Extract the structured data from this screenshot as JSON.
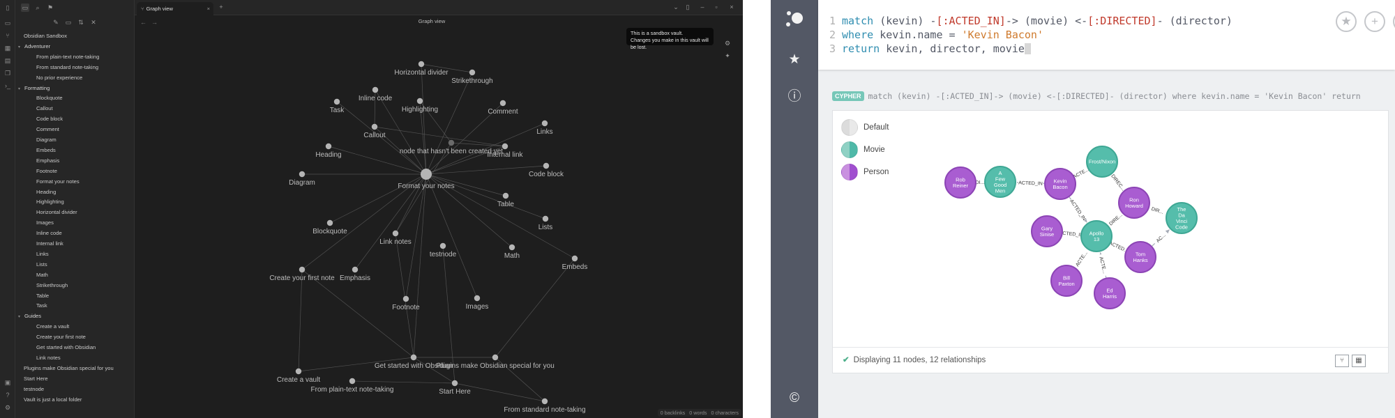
{
  "obsidian": {
    "tab_label": "Graph view",
    "graph_title": "Graph view",
    "tooltip_line1": "This is a sandbox vault.",
    "tooltip_line2": "Changes you make in this vault will be lost.",
    "status": {
      "backlinks": "0 backlinks",
      "words": "0 words",
      "characters": "0 characters"
    },
    "tree": [
      {
        "label": "Obsidian Sandbox",
        "level": 0,
        "kind": "root"
      },
      {
        "label": "Adventurer",
        "level": 0,
        "kind": "folder"
      },
      {
        "label": "From plain-text note-taking",
        "level": 1,
        "kind": "file"
      },
      {
        "label": "From standard note-taking",
        "level": 1,
        "kind": "file"
      },
      {
        "label": "No prior experience",
        "level": 1,
        "kind": "file"
      },
      {
        "label": "Formatting",
        "level": 0,
        "kind": "folder"
      },
      {
        "label": "Blockquote",
        "level": 1,
        "kind": "file"
      },
      {
        "label": "Callout",
        "level": 1,
        "kind": "file"
      },
      {
        "label": "Code block",
        "level": 1,
        "kind": "file"
      },
      {
        "label": "Comment",
        "level": 1,
        "kind": "file"
      },
      {
        "label": "Diagram",
        "level": 1,
        "kind": "file"
      },
      {
        "label": "Embeds",
        "level": 1,
        "kind": "file"
      },
      {
        "label": "Emphasis",
        "level": 1,
        "kind": "file"
      },
      {
        "label": "Footnote",
        "level": 1,
        "kind": "file"
      },
      {
        "label": "Format your notes",
        "level": 1,
        "kind": "file"
      },
      {
        "label": "Heading",
        "level": 1,
        "kind": "file"
      },
      {
        "label": "Highlighting",
        "level": 1,
        "kind": "file"
      },
      {
        "label": "Horizontal divider",
        "level": 1,
        "kind": "file"
      },
      {
        "label": "Images",
        "level": 1,
        "kind": "file"
      },
      {
        "label": "Inline code",
        "level": 1,
        "kind": "file"
      },
      {
        "label": "Internal link",
        "level": 1,
        "kind": "file"
      },
      {
        "label": "Links",
        "level": 1,
        "kind": "file"
      },
      {
        "label": "Lists",
        "level": 1,
        "kind": "file"
      },
      {
        "label": "Math",
        "level": 1,
        "kind": "file"
      },
      {
        "label": "Strikethrough",
        "level": 1,
        "kind": "file"
      },
      {
        "label": "Table",
        "level": 1,
        "kind": "file"
      },
      {
        "label": "Task",
        "level": 1,
        "kind": "file"
      },
      {
        "label": "Guides",
        "level": 0,
        "kind": "folder"
      },
      {
        "label": "Create a vault",
        "level": 1,
        "kind": "file"
      },
      {
        "label": "Create your first note",
        "level": 1,
        "kind": "file"
      },
      {
        "label": "Get started with Obsidian",
        "level": 1,
        "kind": "file"
      },
      {
        "label": "Link notes",
        "level": 1,
        "kind": "file"
      },
      {
        "label": "Plugins make Obsidian special for you",
        "level": 0,
        "kind": "file"
      },
      {
        "label": "Start Here",
        "level": 0,
        "kind": "file"
      },
      {
        "label": "testnode",
        "level": 0,
        "kind": "file"
      },
      {
        "label": "Vault is just a local folder",
        "level": 0,
        "kind": "file"
      }
    ],
    "graph_nodes": [
      {
        "id": "hdiv",
        "label": "Horizontal divider"
      },
      {
        "id": "strike",
        "label": "Strikethrough"
      },
      {
        "id": "inline",
        "label": "Inline code"
      },
      {
        "id": "task",
        "label": "Task"
      },
      {
        "id": "highlight",
        "label": "Highlighting"
      },
      {
        "id": "comment",
        "label": "Comment"
      },
      {
        "id": "links",
        "label": "Links"
      },
      {
        "id": "callout",
        "label": "Callout"
      },
      {
        "id": "notcreated",
        "label": "node that hasn't been created yet"
      },
      {
        "id": "heading",
        "label": "Heading"
      },
      {
        "id": "internal",
        "label": "Internal link"
      },
      {
        "id": "codeblock",
        "label": "Code block"
      },
      {
        "id": "diagram",
        "label": "Diagram"
      },
      {
        "id": "format",
        "label": "Format your notes"
      },
      {
        "id": "table",
        "label": "Table"
      },
      {
        "id": "lists",
        "label": "Lists"
      },
      {
        "id": "blockquote",
        "label": "Blockquote"
      },
      {
        "id": "linknotes",
        "label": "Link notes"
      },
      {
        "id": "testnode",
        "label": "testnode"
      },
      {
        "id": "math",
        "label": "Math"
      },
      {
        "id": "embeds",
        "label": "Embeds"
      },
      {
        "id": "firstnote",
        "label": "Create your first note"
      },
      {
        "id": "emphasis",
        "label": "Emphasis"
      },
      {
        "id": "footnote",
        "label": "Footnote"
      },
      {
        "id": "images",
        "label": "Images"
      },
      {
        "id": "getstarted",
        "label": "Get started with Obsidian"
      },
      {
        "id": "plugins",
        "label": "Plugins make Obsidian special for you"
      },
      {
        "id": "vault",
        "label": "Create a vault"
      },
      {
        "id": "plaintext",
        "label": "From plain-text note-taking"
      },
      {
        "id": "starthere",
        "label": "Start Here"
      },
      {
        "id": "standard",
        "label": "From standard note-taking"
      }
    ],
    "graph_edges": [
      [
        "format",
        "hdiv"
      ],
      [
        "format",
        "strike"
      ],
      [
        "format",
        "inline"
      ],
      [
        "format",
        "task"
      ],
      [
        "format",
        "highlight"
      ],
      [
        "format",
        "comment"
      ],
      [
        "format",
        "links"
      ],
      [
        "format",
        "callout"
      ],
      [
        "format",
        "heading"
      ],
      [
        "format",
        "internal"
      ],
      [
        "format",
        "codeblock"
      ],
      [
        "format",
        "diagram"
      ],
      [
        "format",
        "table"
      ],
      [
        "format",
        "lists"
      ],
      [
        "format",
        "blockquote"
      ],
      [
        "format",
        "math"
      ],
      [
        "format",
        "embeds"
      ],
      [
        "format",
        "emphasis"
      ],
      [
        "format",
        "footnote"
      ],
      [
        "format",
        "images"
      ],
      [
        "format",
        "firstnote"
      ],
      [
        "format",
        "linknotes"
      ],
      [
        "format",
        "getstarted"
      ],
      [
        "callout",
        "internal"
      ],
      [
        "highlight",
        "notcreated"
      ],
      [
        "internal",
        "notcreated"
      ],
      [
        "testnode",
        "starthere"
      ],
      [
        "linknotes",
        "notcreated"
      ],
      [
        "getstarted",
        "vault"
      ],
      [
        "getstarted",
        "firstnote"
      ],
      [
        "getstarted",
        "linknotes"
      ],
      [
        "getstarted",
        "plugins"
      ],
      [
        "getstarted",
        "starthere"
      ],
      [
        "plugins",
        "embeds"
      ],
      [
        "starthere",
        "standard"
      ],
      [
        "starthere",
        "plaintext"
      ],
      [
        "plugins",
        "standard"
      ],
      [
        "firstnote",
        "vault"
      ],
      [
        "strike",
        "hdiv"
      ],
      [
        "callout",
        "inline"
      ]
    ]
  },
  "neo4j": {
    "query_lines": [
      {
        "num": "1",
        "parts": [
          [
            "kw",
            "match "
          ],
          [
            "t",
            "(kevin) -"
          ],
          [
            "rel",
            "[:ACTED_IN]"
          ],
          [
            "t",
            "-> (movie) <-"
          ],
          [
            "rel",
            "[:DIRECTED]"
          ],
          [
            "t",
            "- (director)"
          ]
        ]
      },
      {
        "num": "2",
        "parts": [
          [
            "kw",
            "where "
          ],
          [
            "t",
            "kevin.name = "
          ],
          [
            "str",
            "'Kevin Bacon'"
          ]
        ]
      },
      {
        "num": "3",
        "parts": [
          [
            "kw",
            "return "
          ],
          [
            "t",
            "kevin, director, movie"
          ]
        ]
      }
    ],
    "badge": "CYPHER",
    "query_summary": "match (kevin) -[:ACTED_IN]-> (movie) <-[:DIRECTED]- (director) where kevin.name = 'Kevin Bacon' return",
    "legend": [
      {
        "label": "Default",
        "left": "#dcdcdc",
        "right": "#e9e9e9"
      },
      {
        "label": "Movie",
        "left": "#8fd1c4",
        "right": "#4fb9a8"
      },
      {
        "label": "Person",
        "left": "#c990e0",
        "right": "#a04fcf"
      }
    ],
    "footer": "Displaying 11 nodes, 12 relationships",
    "colors": {
      "movie": "#55bdab",
      "movie_stroke": "#3ea794",
      "person": "#a95dd1",
      "person_stroke": "#8c44b5"
    },
    "nodes": [
      {
        "id": "rob",
        "label": [
          "Rob",
          "Reiner"
        ],
        "type": "person"
      },
      {
        "id": "afgm",
        "label": [
          "A",
          "Few",
          "Good",
          "Men"
        ],
        "type": "movie"
      },
      {
        "id": "kevin",
        "label": [
          "Kevin",
          "Bacon"
        ],
        "type": "person"
      },
      {
        "id": "frost",
        "label": [
          "Frost/Nixon"
        ],
        "type": "movie"
      },
      {
        "id": "ron",
        "label": [
          "Ron",
          "Howard"
        ],
        "type": "person"
      },
      {
        "id": "davinci",
        "label": [
          "The",
          "Da",
          "Vinci",
          "Code"
        ],
        "type": "movie"
      },
      {
        "id": "gary",
        "label": [
          "Gary",
          "Sinise"
        ],
        "type": "person"
      },
      {
        "id": "apollo",
        "label": [
          "Apollo",
          "13"
        ],
        "type": "movie"
      },
      {
        "id": "tom",
        "label": [
          "Tom",
          "Hanks"
        ],
        "type": "person"
      },
      {
        "id": "bill",
        "label": [
          "Bill",
          "Paxton"
        ],
        "type": "person"
      },
      {
        "id": "ed",
        "label": [
          "Ed",
          "Harris"
        ],
        "type": "person"
      }
    ],
    "edges": [
      {
        "from": "rob",
        "to": "afgm",
        "label": "DI..."
      },
      {
        "from": "kevin",
        "to": "afgm",
        "label": "ACTED_IN"
      },
      {
        "from": "kevin",
        "to": "frost",
        "label": "ACTE..."
      },
      {
        "from": "ron",
        "to": "frost",
        "label": "DIREC..."
      },
      {
        "from": "kevin",
        "to": "apollo",
        "label": "ACTED_IN"
      },
      {
        "from": "ron",
        "to": "apollo",
        "label": "DIRE..."
      },
      {
        "from": "ron",
        "to": "davinci",
        "label": "DIR..."
      },
      {
        "from": "gary",
        "to": "apollo",
        "label": "ACTED_IN"
      },
      {
        "from": "tom",
        "to": "apollo",
        "label": "ACTED..."
      },
      {
        "from": "tom",
        "to": "davinci",
        "label": "AC..."
      },
      {
        "from": "bill",
        "to": "apollo",
        "label": "ACTE..."
      },
      {
        "from": "ed",
        "to": "apollo",
        "label": "ACTE..."
      }
    ]
  }
}
